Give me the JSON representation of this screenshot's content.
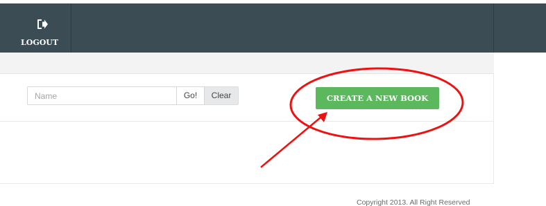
{
  "topbar": {
    "logout_label": "LOGOUT",
    "logout_icon": "logout-icon",
    "background_color": "#3b4c55"
  },
  "search": {
    "placeholder": "Name",
    "value": "",
    "go_label": "Go!",
    "clear_label": "Clear"
  },
  "actions": {
    "create_label": "CREATE A NEW BOOK",
    "create_color": "#5cb85c"
  },
  "annotation": {
    "color": "#ee1111",
    "shapes": [
      "ellipse",
      "arrow"
    ]
  },
  "footer": {
    "copyright": "Copyright 2013. All Right Reserved"
  }
}
